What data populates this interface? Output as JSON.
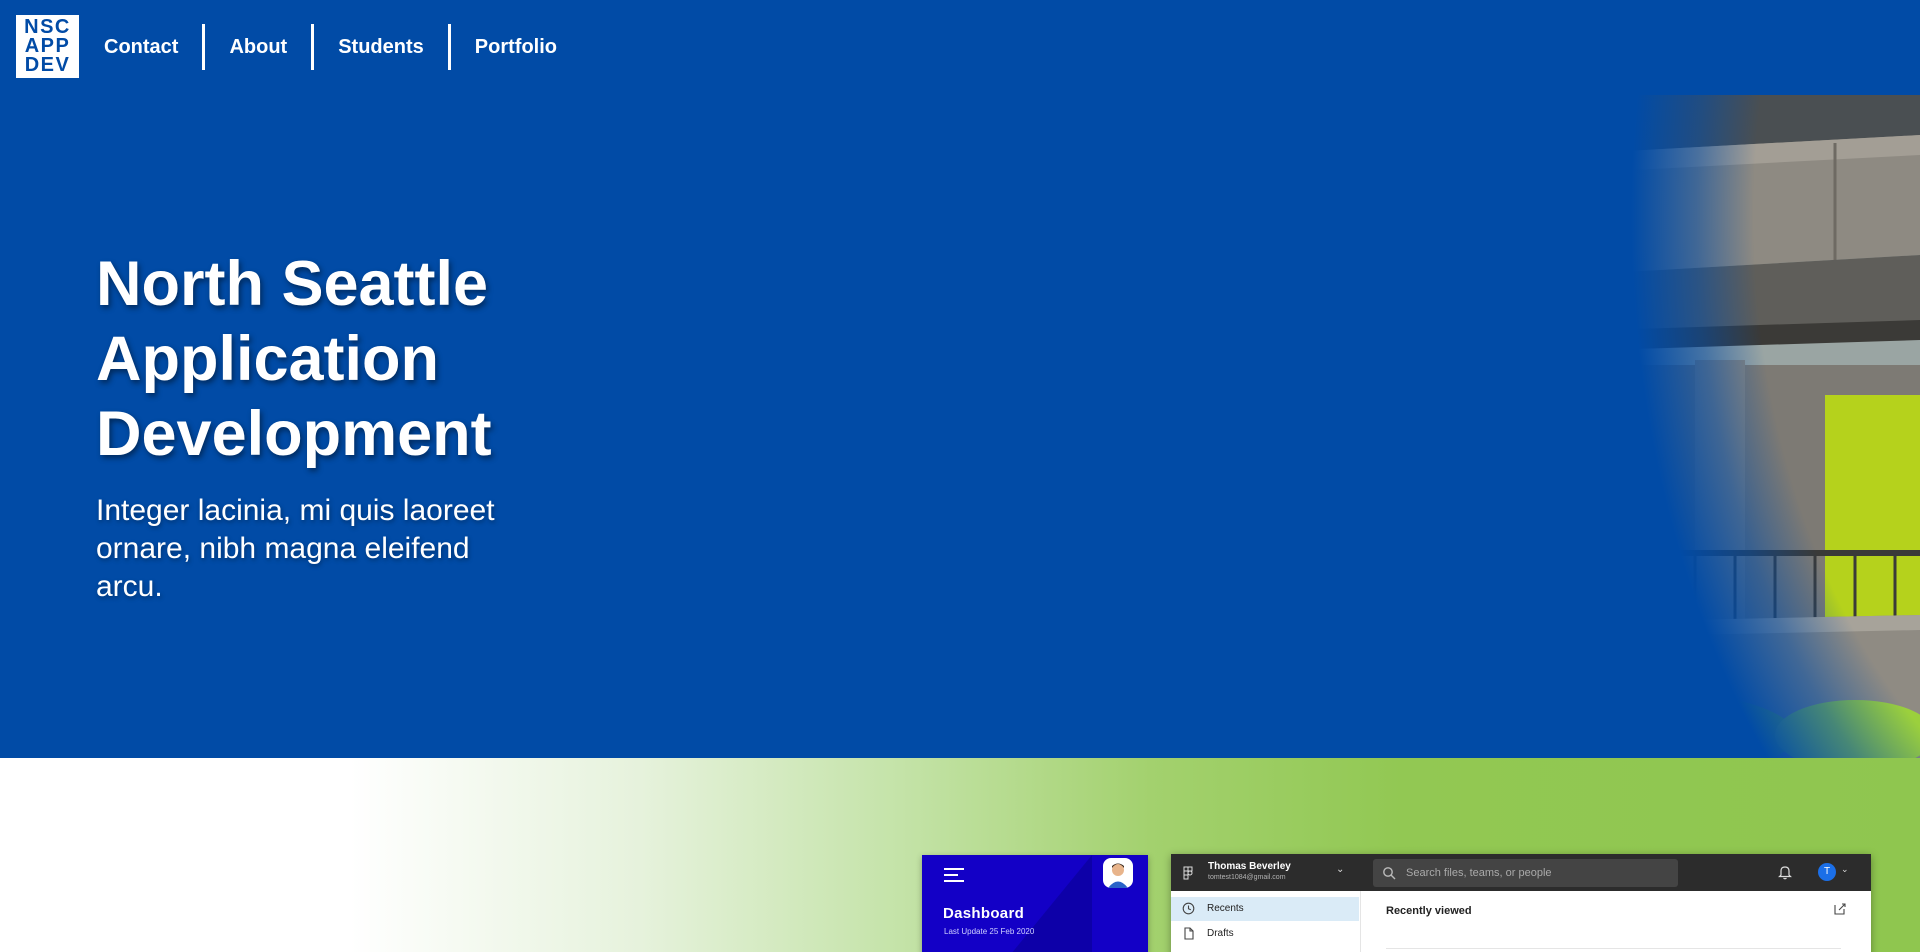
{
  "logo": {
    "lines": [
      "NSC",
      "APP",
      "DEV"
    ]
  },
  "nav": {
    "items": [
      {
        "label": "Contact"
      },
      {
        "label": "About"
      },
      {
        "label": "Students"
      },
      {
        "label": "Portfolio"
      }
    ]
  },
  "hero": {
    "title": "North Seattle Application Development",
    "subtitle": "Integer lacinia, mi quis laoreet ornare, nibh magna eleifend arcu."
  },
  "showcase": {
    "dashboard": {
      "title": "Dashboard",
      "subtitle": "Last Update 25 Feb 2020"
    },
    "app": {
      "user_name": "Thomas Beverley",
      "user_email": "tomtest1084@gmail.com",
      "search_placeholder": "Search files, teams, or people",
      "avatar_letter": "T",
      "sidebar": [
        {
          "label": "Recents",
          "icon": "clock-icon"
        },
        {
          "label": "Drafts",
          "icon": "file-icon"
        }
      ],
      "section_title": "Recently viewed"
    }
  },
  "colors": {
    "brand_blue": "#014ba6",
    "green": "#8fc64f",
    "dashboard_blue": "#1300c6"
  }
}
